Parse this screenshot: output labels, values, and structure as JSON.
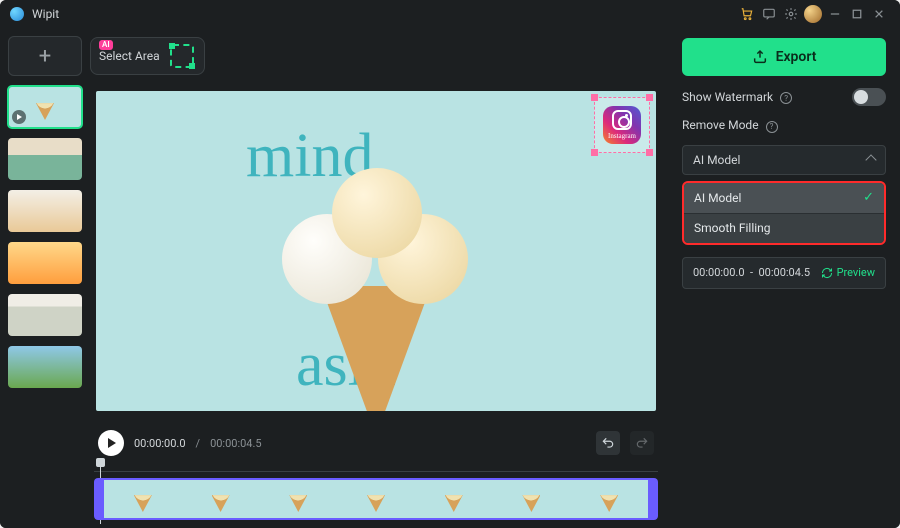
{
  "app": {
    "title": "Wipit"
  },
  "titlebar_icons": [
    "cart",
    "chat",
    "gear",
    "avatar"
  ],
  "thumbs": {
    "items": [
      {
        "id": "ice",
        "selected": true,
        "has_play": true
      },
      {
        "id": "room"
      },
      {
        "id": "food"
      },
      {
        "id": "melt"
      },
      {
        "id": "shirt"
      },
      {
        "id": "out"
      }
    ]
  },
  "toolbar": {
    "ai_badge": "AI",
    "select_area_label": "Select Area"
  },
  "preview": {
    "overlay_text_top": "mind",
    "overlay_text_bottom": "asin",
    "watermark_label": "Instagram"
  },
  "playback": {
    "current": "00:00:00.0",
    "total": "00:00:04.5"
  },
  "right": {
    "export_label": "Export",
    "show_watermark_label": "Show Watermark",
    "show_watermark_on": false,
    "remove_mode_label": "Remove Mode",
    "remove_mode_selected": "AI Model",
    "remove_mode_options": [
      "AI Model",
      "Smooth Filling"
    ],
    "time_start": "00:00:00.0",
    "time_sep": "-",
    "time_end": "00:00:04.5",
    "preview_label": "Preview"
  }
}
